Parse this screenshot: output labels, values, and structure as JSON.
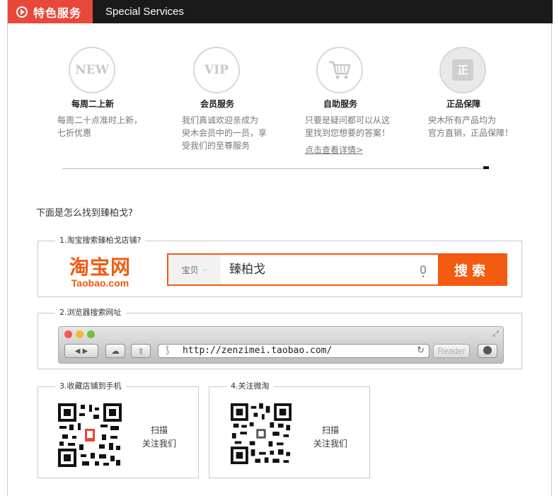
{
  "header": {
    "title_cn": "特色服务",
    "title_en": "Special Services"
  },
  "features": [
    {
      "icon_text": "NEW",
      "title": "每周二上新",
      "desc_lines": [
        "每周二十点准时上新，",
        "七折优惠"
      ],
      "link": ""
    },
    {
      "icon_text": "VIP",
      "title": "会员服务",
      "desc_lines": [
        "我们真诚欢迎亲成为",
        "臾木会员中的一员，享",
        "受我们的至尊服务"
      ],
      "link": ""
    },
    {
      "icon_text": "",
      "title": "自助服务",
      "desc_lines": [
        "只要是疑问都可以从这",
        "里找到您想要的答案！"
      ],
      "link": "点击查看详情>"
    },
    {
      "icon_text": "正",
      "title": "正品保障",
      "desc_lines": [
        "臾木所有产品均为",
        "官方直销，正品保障！"
      ],
      "link": ""
    }
  ],
  "question": "下面是怎么找到臻柏戈?",
  "step1": {
    "legend": "1.淘宝搜索臻柏戈店铺?",
    "logo_cn": "淘宝网",
    "logo_en": "Taobao.com",
    "category": "宝贝",
    "query": "臻柏戈",
    "button": "搜索"
  },
  "step2": {
    "legend": "2.浏览器搜索网址",
    "url": "http://zenzimei.taobao.com/",
    "reader": "Reader"
  },
  "step3": {
    "legend": "3.收藏店铺到手机",
    "caption": [
      "扫描",
      "关注我们"
    ]
  },
  "step4": {
    "legend": "4.关注微淘",
    "caption": [
      "扫描",
      "关注我们"
    ]
  },
  "colors": {
    "accent_red": "#e8483a",
    "taobao_orange": "#f25b10",
    "header_dark": "#1a1a1a"
  }
}
